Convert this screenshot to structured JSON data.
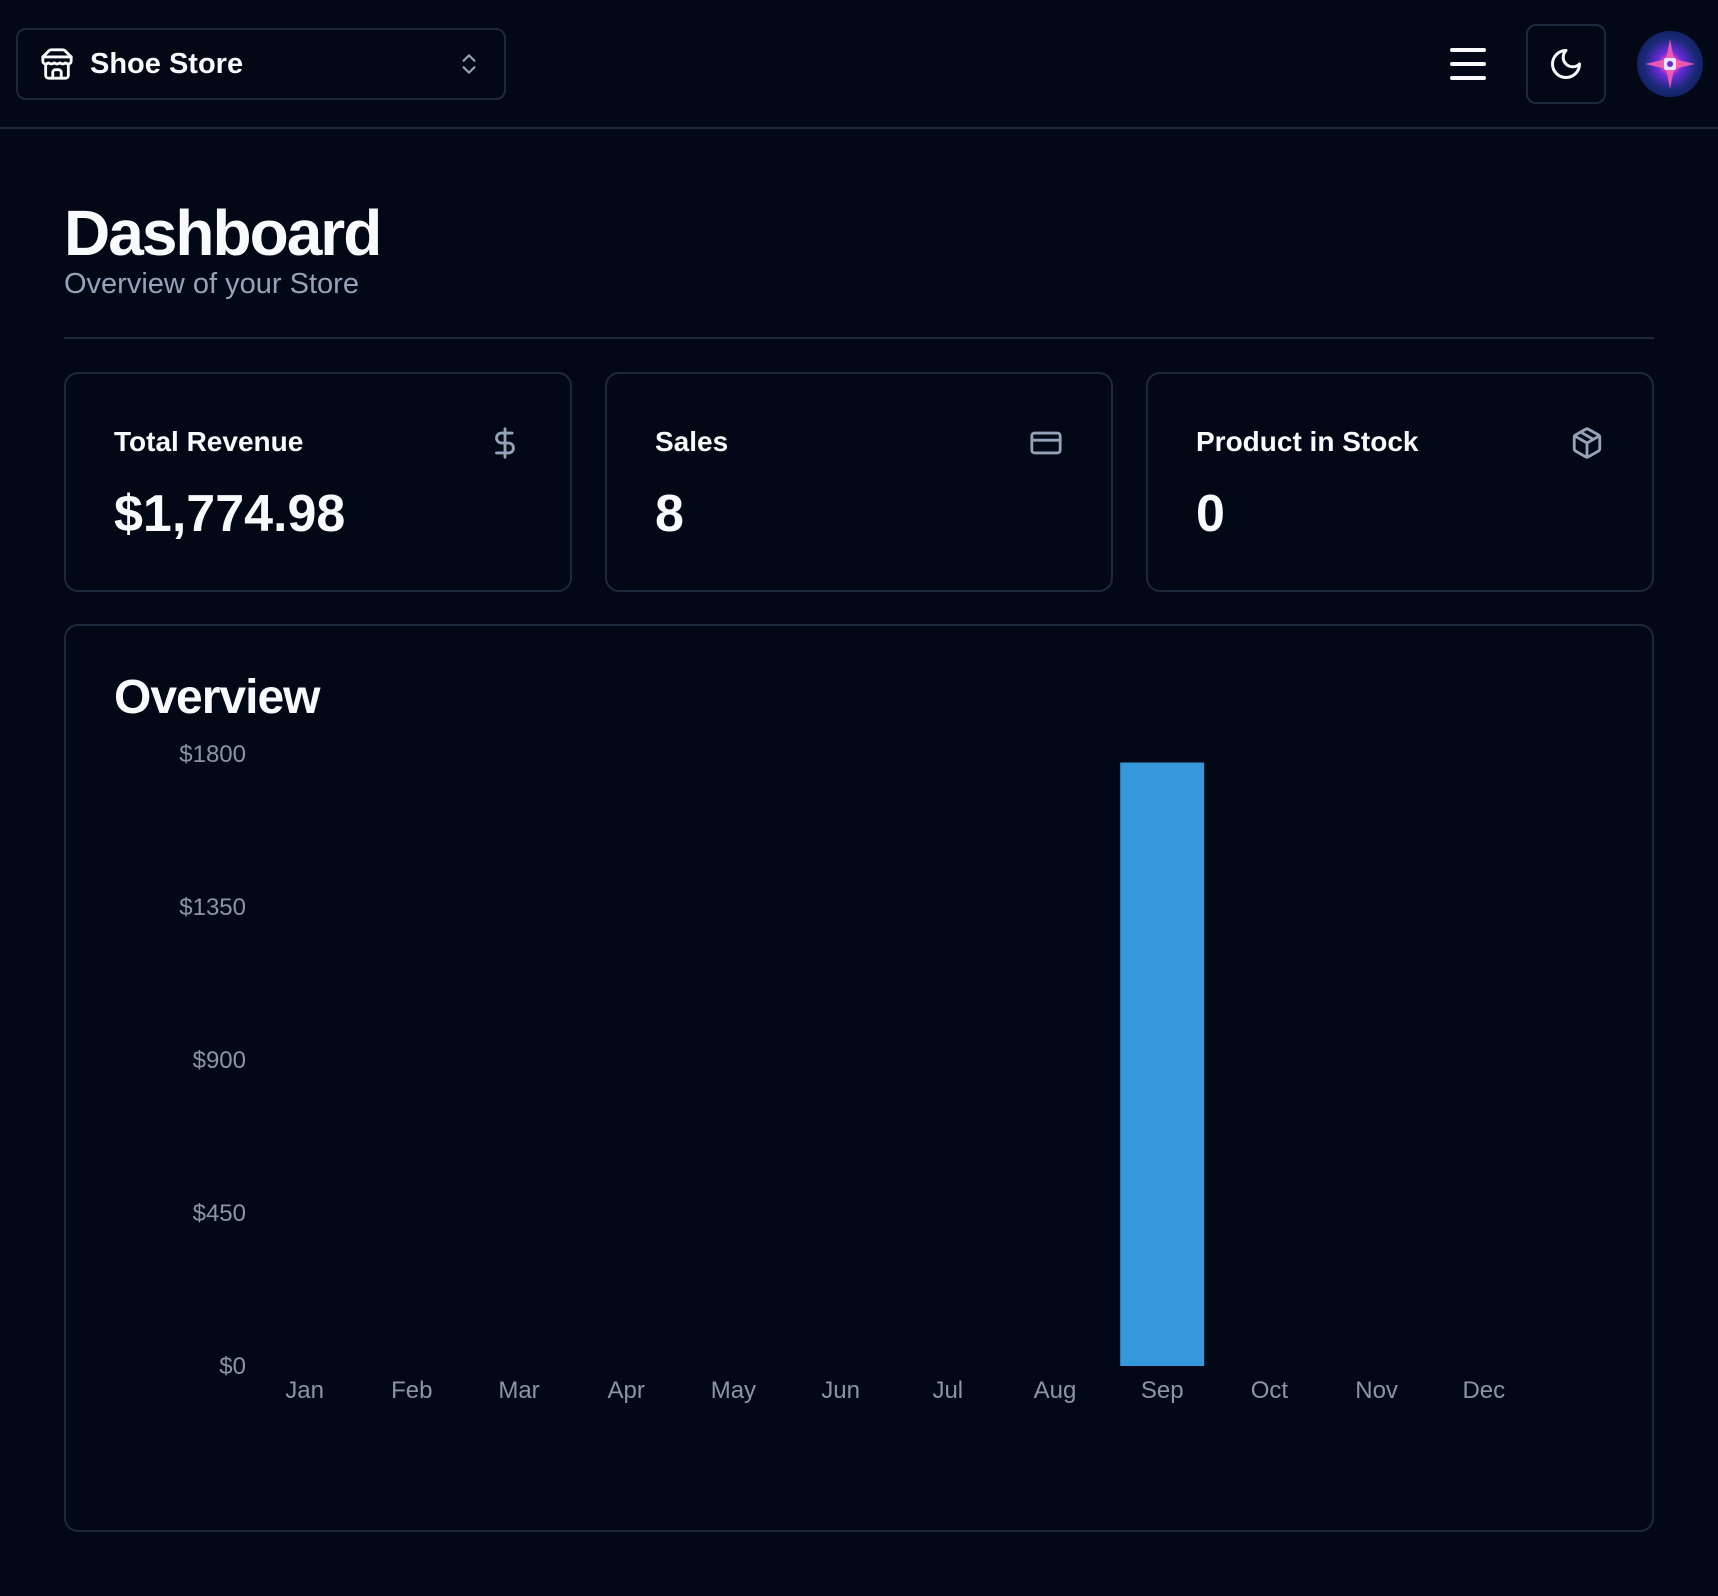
{
  "header": {
    "store_name": "Shoe Store",
    "store_icon": "store-icon",
    "menu_icon": "hamburger-menu-icon",
    "theme_icon": "moon-icon",
    "avatar": "user-avatar"
  },
  "page": {
    "title": "Dashboard",
    "subtitle": "Overview of your Store"
  },
  "cards": [
    {
      "label": "Total Revenue",
      "value": "$1,774.98",
      "icon": "dollar-sign-icon"
    },
    {
      "label": "Sales",
      "value": "8",
      "icon": "credit-card-icon"
    },
    {
      "label": "Product in Stock",
      "value": "0",
      "icon": "package-icon"
    }
  ],
  "overview": {
    "title": "Overview"
  },
  "chart_data": {
    "type": "bar",
    "categories": [
      "Jan",
      "Feb",
      "Mar",
      "Apr",
      "May",
      "Jun",
      "Jul",
      "Aug",
      "Sep",
      "Oct",
      "Nov",
      "Dec"
    ],
    "values": [
      0,
      0,
      0,
      0,
      0,
      0,
      0,
      0,
      1774.98,
      0,
      0,
      0
    ],
    "yticks": [
      "$0",
      "$450",
      "$900",
      "$1350",
      "$1800"
    ],
    "ylim": [
      0,
      1800
    ],
    "bar_color": "#3498db",
    "title": "Overview",
    "xlabel": "",
    "ylabel": "",
    "grid": false
  },
  "colors": {
    "background": "#030817",
    "border": "#1e293b",
    "text": "#f8fafc",
    "muted": "#94a3b8",
    "bar": "#3498db"
  }
}
